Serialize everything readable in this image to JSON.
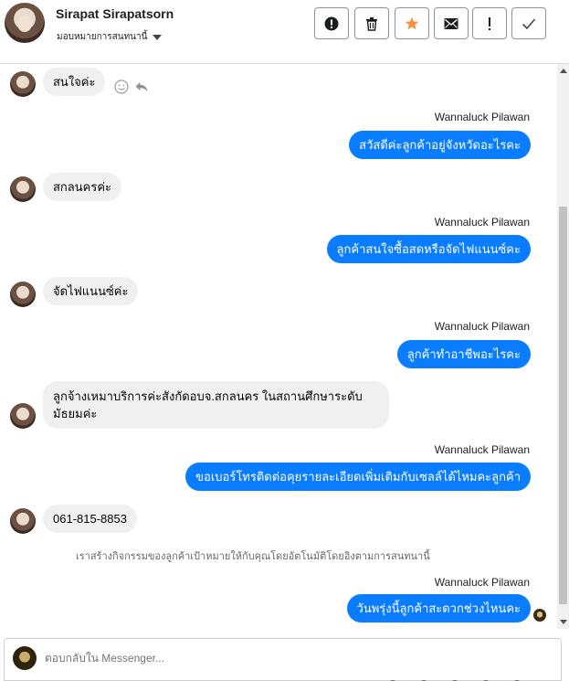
{
  "header": {
    "name": "Sirapat Sirapatsorn",
    "assign_label": "มอบหมายการสนทนานี้",
    "buttons": {
      "spam": "spam-alert-icon",
      "delete": "trash-icon",
      "star": "star-icon",
      "mark_unread": "envelope-icon",
      "flag": "exclamation-icon",
      "done": "check-icon"
    },
    "star_color": "#f7923b"
  },
  "messages": [
    {
      "from": "customer",
      "text": "สนใจค่ะ"
    },
    {
      "from": "page",
      "sender": "Wannaluck Pilawan",
      "text": "สวัสดีค่ะลูกค้าอยู่จังหวัดอะไรคะ"
    },
    {
      "from": "customer",
      "text": "สกลนครค่ะ"
    },
    {
      "from": "page",
      "sender": "Wannaluck Pilawan",
      "text": "ลูกค้าสนใจซื้อสดหรือจัดไฟแนนซ์คะ"
    },
    {
      "from": "customer",
      "text": "จัดไฟแนนซ์ค่ะ"
    },
    {
      "from": "page",
      "sender": "Wannaluck Pilawan",
      "text": "ลูกค้าทำอาชีพอะไรคะ"
    },
    {
      "from": "customer",
      "text": "ลูกจ้างเหมาบริการค่ะสังกัดอบจ.สกลนคร ในสถานศึกษาระดับมัธยมค่ะ"
    },
    {
      "from": "page",
      "sender": "Wannaluck Pilawan",
      "text": "ขอเบอร์โทรติดต่อคุยรายละเอียดเพิ่มเติมกับเซลล์ได้ไหมคะลูกค้า"
    },
    {
      "from": "customer",
      "text": "061-815-8853"
    },
    {
      "from": "page",
      "sender": "Wannaluck Pilawan",
      "text": "วันพรุ่งนี้ลูกค้าสะดวกช่วงไหนคะ"
    }
  ],
  "system_note": "เราสร้างกิจกรรมของลูกค้าเป้าหมายให้กับคุณโดยอัตโนมัติโดยอิงตามการสนทนานี้",
  "composer": {
    "placeholder": "ตอบกลับใน Messenger..."
  },
  "colors": {
    "outgoing_bubble": "#0a7cff",
    "incoming_bubble": "#f0f0f0"
  }
}
